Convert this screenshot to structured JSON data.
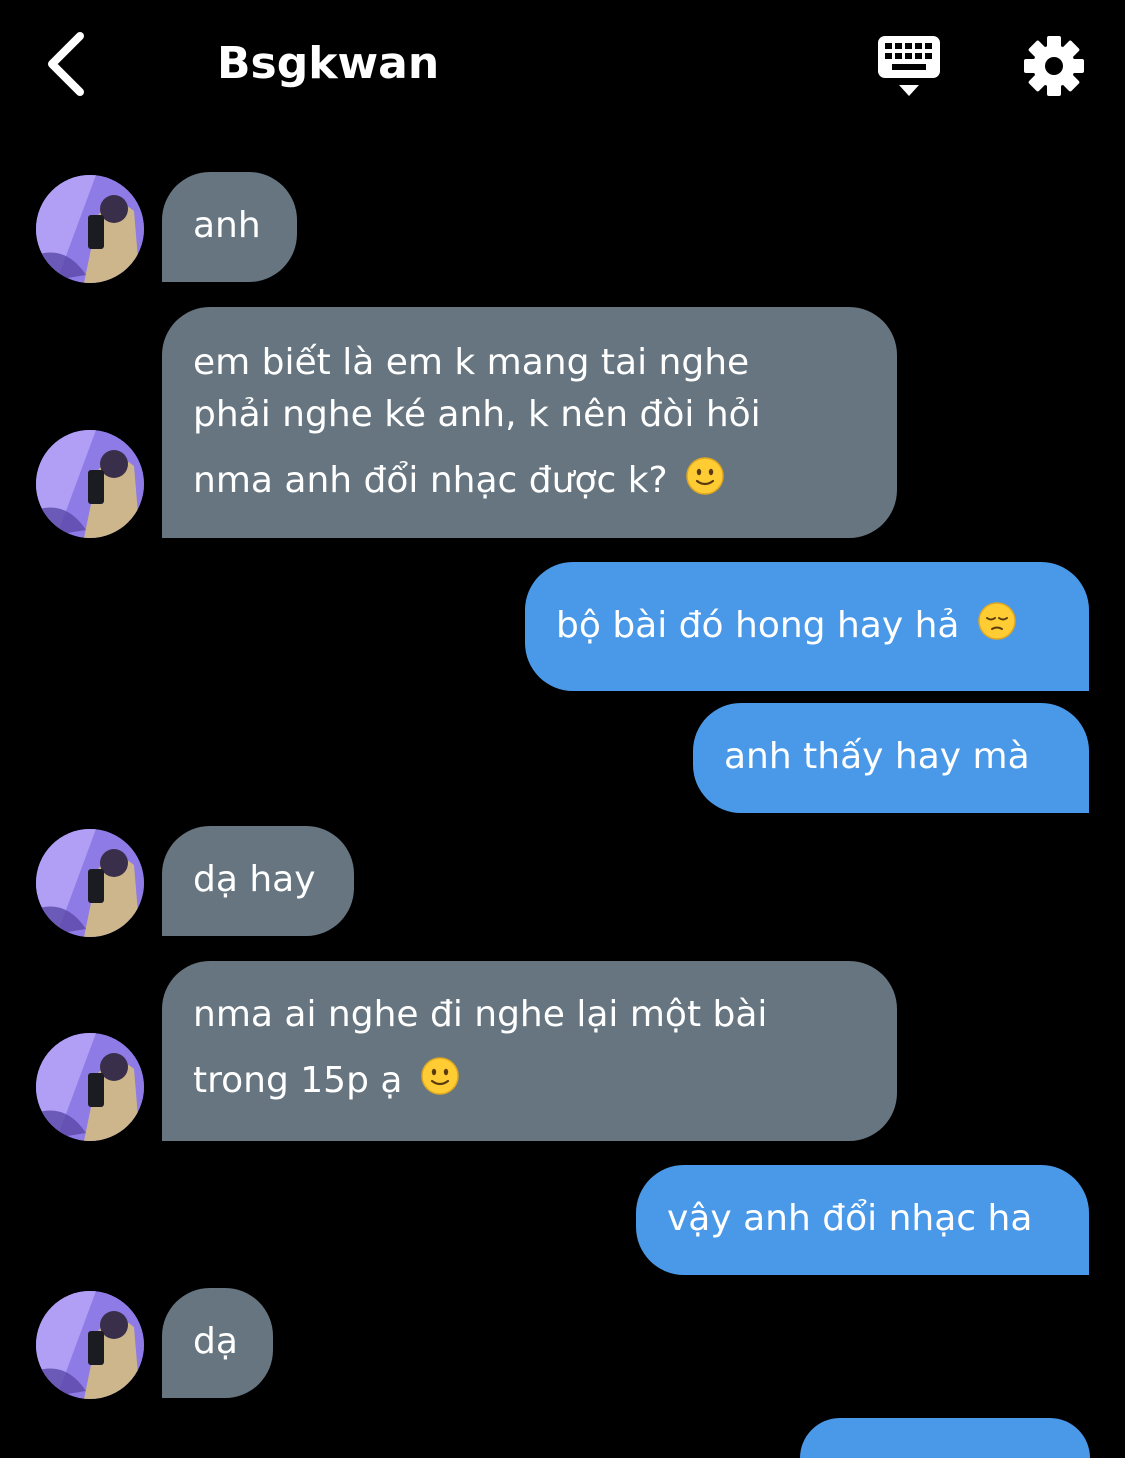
{
  "header": {
    "title": "Bsgkwan",
    "back_icon": "chevron-left-icon",
    "keyboard_icon": "keyboard-icon",
    "settings_icon": "gear-icon"
  },
  "colors": {
    "background": "#000000",
    "incoming_bubble": "#66757f",
    "outgoing_bubble": "#4a99e9",
    "text": "#ffffff"
  },
  "messages": [
    {
      "sender": "them",
      "lines": [
        "anh"
      ]
    },
    {
      "sender": "them",
      "lines": [
        "em biết là em k mang tai nghe",
        "phải nghe ké anh, k nên đòi hỏi",
        "nma anh đổi nhạc được k?"
      ],
      "emoji": "slightly-smiling-face-icon"
    },
    {
      "sender": "me",
      "lines": [
        "bộ bài đó hong hay hả"
      ],
      "emoji": "pensive-face-icon"
    },
    {
      "sender": "me",
      "lines": [
        "anh thấy hay mà"
      ]
    },
    {
      "sender": "them",
      "lines": [
        "dạ hay"
      ]
    },
    {
      "sender": "them",
      "lines": [
        "nma ai nghe đi nghe lại một bài",
        "trong 15p ạ"
      ],
      "emoji": "slightly-smiling-face-icon"
    },
    {
      "sender": "me",
      "lines": [
        "vậy anh đổi nhạc ha"
      ]
    },
    {
      "sender": "them",
      "lines": [
        "dạ"
      ]
    }
  ]
}
